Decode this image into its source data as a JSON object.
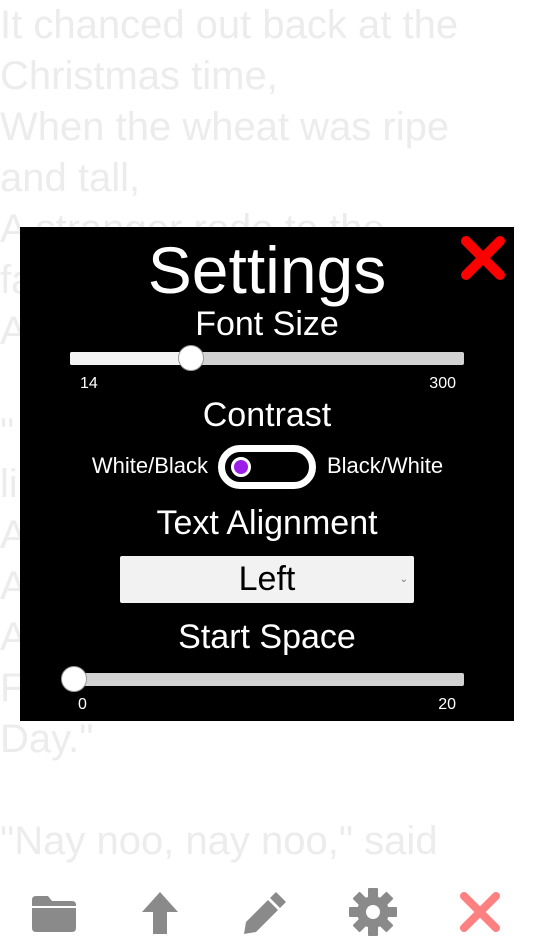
{
  "background": {
    "lines": [
      "It chanced out back at the",
      "Christmas time,",
      "When the wheat was ripe",
      "and tall,",
      "A stranger rode to the",
      "fa",
      "A",
      "",
      "\"",
      "li",
      "A",
      "A",
      "A",
      "F",
      "Day.\"",
      "",
      "\"Nay noo, nay noo,\" said"
    ]
  },
  "settings": {
    "title": "Settings",
    "font_size": {
      "label": "Font Size",
      "min_label": "14",
      "max_label": "300",
      "min": 14,
      "max": 300,
      "value": 102
    },
    "contrast": {
      "label": "Contrast",
      "left_option": "White/Black",
      "right_option": "Black/White",
      "selected": "White/Black"
    },
    "text_alignment": {
      "label": "Text Alignment",
      "value": "Left"
    },
    "start_space": {
      "label": "Start Space",
      "min_label": "0",
      "max_label": "20",
      "min": 0,
      "max": 20,
      "value": 0
    }
  },
  "colors": {
    "modal_bg": "#000000",
    "close_red": "#ff0000",
    "toggle_knob": "#9c1ee8",
    "toolbar_icon": "#8a8a8a",
    "toolbar_close": "#ff8080",
    "background_text": "#ececec"
  },
  "toolbar": {
    "icons": [
      "folder-icon",
      "arrow-up-icon",
      "pencil-icon",
      "gear-icon",
      "close-icon"
    ]
  }
}
